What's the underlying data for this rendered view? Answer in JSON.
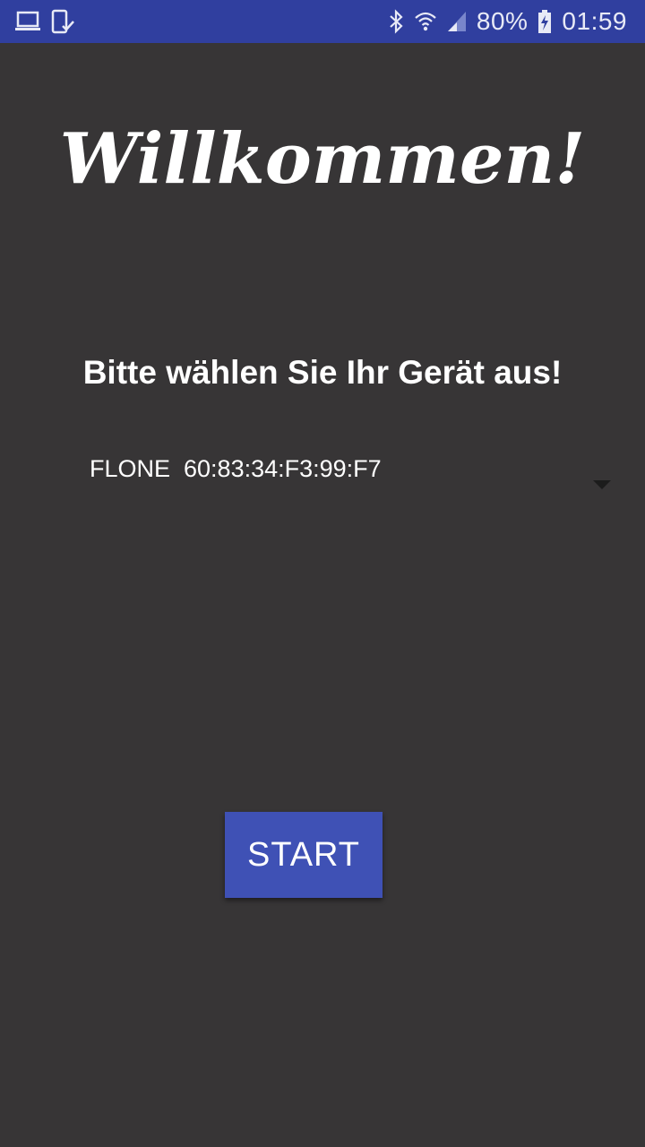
{
  "status_bar": {
    "battery": "80%",
    "time": "01:59",
    "left_icons": [
      "laptop-icon",
      "device-check-icon"
    ],
    "right_icons": [
      "bluetooth-icon",
      "wifi-icon",
      "signal-icon",
      "battery-charging-icon"
    ],
    "bg_color": "#303f9f"
  },
  "main": {
    "welcome_title": "Willkommen!",
    "prompt": "Bitte wählen Sie Ihr Gerät aus!",
    "device_spinner": {
      "selected": "FLONE  60:83:34:F3:99:F7"
    },
    "start_button": {
      "label": "START",
      "color": "#3f51b5"
    },
    "bg_color": "#373536"
  }
}
